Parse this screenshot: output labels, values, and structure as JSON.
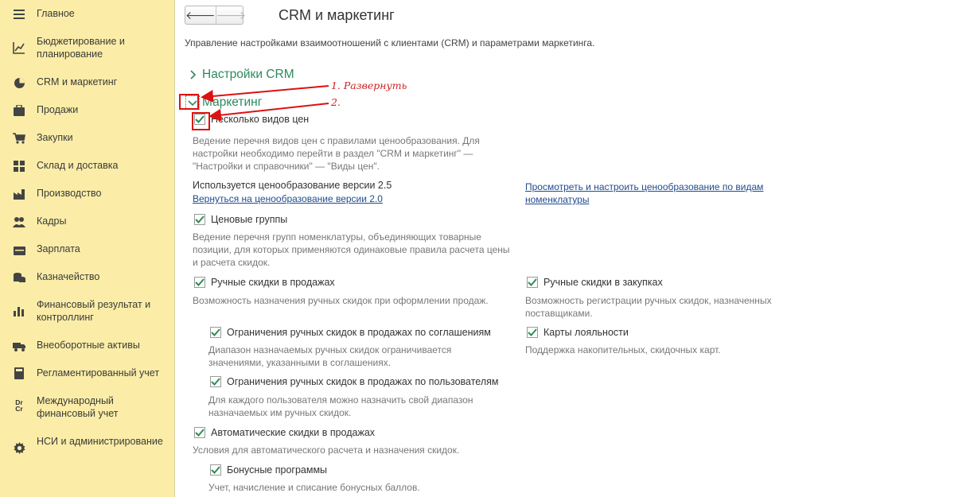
{
  "sidebar": {
    "items": [
      {
        "label": "Главное",
        "icon": "menu-icon"
      },
      {
        "label": "Бюджетирование и планирование",
        "icon": "chart-trend-icon"
      },
      {
        "label": "CRM и маркетинг",
        "icon": "pie-chart-icon"
      },
      {
        "label": "Продажи",
        "icon": "briefcase-icon"
      },
      {
        "label": "Закупки",
        "icon": "cart-icon"
      },
      {
        "label": "Склад и доставка",
        "icon": "warehouse-grid-icon"
      },
      {
        "label": "Производство",
        "icon": "factory-icon"
      },
      {
        "label": "Кадры",
        "icon": "people-icon"
      },
      {
        "label": "Зарплата",
        "icon": "money-icon"
      },
      {
        "label": "Казначейство",
        "icon": "coins-icon"
      },
      {
        "label": "Финансовый результат и контроллинг",
        "icon": "bar-chart-icon"
      },
      {
        "label": "Внеоборотные активы",
        "icon": "truck-icon"
      },
      {
        "label": "Регламентированный учет",
        "icon": "calculator-icon"
      },
      {
        "label": "Международный финансовый учет",
        "icon": "dr-cr-icon"
      },
      {
        "label": "НСИ и администрирование",
        "icon": "gear-icon"
      }
    ],
    "dr_label": "Dr",
    "cr_label": "Cr"
  },
  "header": {
    "back_glyph": "🡐",
    "forward_glyph": "🡒",
    "title": "CRM и маркетинг",
    "description": "Управление настройками взаимоотношений с клиентами (CRM) и параметрами маркетинга."
  },
  "sections": {
    "crm": {
      "label": "Настройки CRM",
      "expanded": false
    },
    "marketing": {
      "label": "Маркетинг",
      "expanded": true
    }
  },
  "annotations": {
    "step1": "1. Развернуть",
    "step2": "2.",
    "color": "#d11111"
  },
  "settings": {
    "multiple_prices": {
      "label": "Несколько видов цен",
      "checked": true,
      "desc": "Ведение перечня видов цен с правилами ценообразования. Для настройки необходимо перейти в раздел \"CRM и маркетинг\" — \"Настройки и справочники\" — \"Виды цен\"."
    },
    "pricing_version": {
      "text": "Используется ценообразование версии 2.5",
      "back_link": "Вернуться на ценообразование версии 2.0",
      "view_link": "Просмотреть и настроить ценообразование по видам номенклатуры"
    },
    "price_groups": {
      "label": "Ценовые группы",
      "checked": true,
      "desc": "Ведение перечня групп номенклатуры, объединяющих товарные позиции, для которых применяются одинаковые правила расчета цены и расчета скидок."
    },
    "manual_discounts_sales": {
      "label": "Ручные скидки в продажах",
      "checked": true,
      "desc": "Возможность назначения ручных скидок при оформлении продаж."
    },
    "manual_discounts_purchases": {
      "label": "Ручные скидки в закупках",
      "checked": true,
      "desc": "Возможность регистрации ручных скидок, назначенных поставщиками."
    },
    "limit_by_agreements": {
      "label": "Ограничения ручных скидок в продажах по соглашениям",
      "checked": true,
      "desc": "Диапазон назначаемых ручных скидок ограничивается значениями, указанными в соглашениях."
    },
    "loyalty_cards": {
      "label": "Карты лояльности",
      "checked": true,
      "desc": "Поддержка накопительных, скидочных карт."
    },
    "limit_by_users": {
      "label": "Ограничения ручных скидок в продажах по пользователям",
      "checked": true,
      "desc": "Для каждого пользователя можно назначить свой диапазон назначаемых им ручных скидок."
    },
    "auto_discounts": {
      "label": "Автоматические скидки в продажах",
      "checked": true,
      "desc": "Условия для автоматического расчета и назначения скидок."
    },
    "bonus_programs": {
      "label": "Бонусные программы",
      "checked": true,
      "desc": "Учет, начисление и списание бонусных баллов."
    }
  },
  "colors": {
    "sidebar_bg": "#fbeda7",
    "section_green": "#2d8a5e",
    "check_green": "#2e8b57",
    "link_blue": "#1f4b8e"
  }
}
